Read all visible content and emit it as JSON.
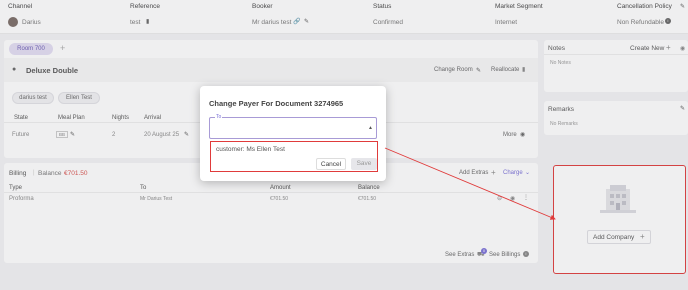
{
  "header": {
    "columns": {
      "channel": "Channel",
      "reference": "Reference",
      "booker": "Booker",
      "status": "Status",
      "market_segment": "Market Segment",
      "cancellation_policy": "Cancellation Policy"
    },
    "row": {
      "channel": "Darius",
      "reference": "test",
      "booker": "Mr darius test",
      "status": "Confirmed",
      "market_segment": "Internet",
      "cancellation_policy": "Non Refundable"
    }
  },
  "room": {
    "tab_label": "Room 700",
    "add_tab": "+",
    "room_type": "Deluxe Double",
    "change_room": "Change Room",
    "reallocate": "Reallocate",
    "guests": [
      "darius test",
      "Ellen Test"
    ],
    "table_headers": [
      "State",
      "Meal Plan",
      "Nights",
      "Arrival"
    ],
    "row": {
      "state": "Future",
      "meal_plan": "BB",
      "nights": "2",
      "arrival": "20 August 25"
    },
    "more": "More"
  },
  "billing": {
    "label": "Billing",
    "balance_label": "Balance",
    "balance_value": "€701.50",
    "add_extras": "Add Extras",
    "charge": "Charge",
    "headers": [
      "Type",
      "To",
      "Amount",
      "Balance"
    ],
    "row": {
      "type": "Proforma",
      "to": "Mr Darius Test",
      "amount": "€701.50",
      "balance": "€701.50"
    },
    "see_extras": "See Extras",
    "see_extras_badge": "0",
    "see_billings": "See Billings"
  },
  "notes": {
    "title": "Notes",
    "create_new": "Create New",
    "empty": "No Notes"
  },
  "remarks": {
    "title": "Remarks",
    "empty": "No Remarks"
  },
  "company": {
    "add_company": "Add Company"
  },
  "modal": {
    "title": "Change Payer For Document 3274965",
    "field_label": "To",
    "option": "customer: Ms Ellen Test",
    "cancel": "Cancel",
    "save": "Save"
  },
  "colors": {
    "accent": "#b9acd9",
    "red": "#e03b3b",
    "balance": "#d9534f"
  }
}
